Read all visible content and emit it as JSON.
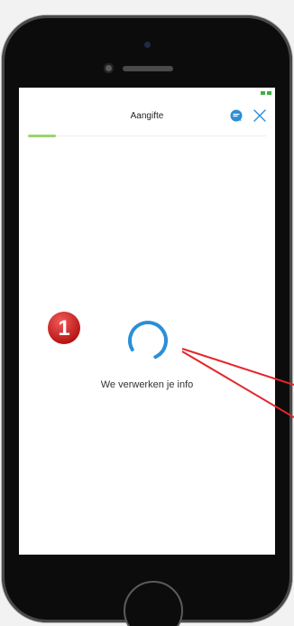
{
  "header": {
    "title": "Aangifte"
  },
  "progress": {
    "value_percent": 12,
    "color": "#9bd36c"
  },
  "loading": {
    "message": "We verwerken je info",
    "spinner_color": "#2a8fd6"
  },
  "annotation": {
    "step_number": "1",
    "badge_color": "#d42424",
    "arrow_color": "#e3262b"
  },
  "icons": {
    "chat": "chat-bubble-icon",
    "close": "close-icon"
  },
  "status": {
    "indicator_color": "#3cb043"
  }
}
